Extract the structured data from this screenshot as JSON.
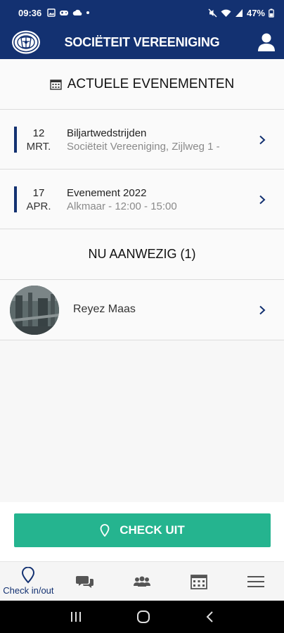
{
  "status_bar": {
    "time": "09:36",
    "battery": "47%"
  },
  "header": {
    "title": "SOCIËTEIT VEREENIGING"
  },
  "events_section": {
    "heading": "ACTUELE EVENEMENTEN",
    "items": [
      {
        "day": "12",
        "month": "MRT.",
        "name": "Biljartwedstrijden",
        "detail": "Sociëteit Vereeniging, Zijlweg 1 -"
      },
      {
        "day": "17",
        "month": "APR.",
        "name": "Evenement 2022",
        "detail": "Alkmaar - 12:00 - 15:00"
      }
    ]
  },
  "present_section": {
    "heading": "NU AANWEZIG (1)",
    "people": [
      {
        "name": "Reyez Maas"
      }
    ]
  },
  "checkout": {
    "label": "CHECK UIT"
  },
  "tabbar": {
    "items": [
      {
        "label": "Check in/out",
        "icon": "location-pin-icon"
      },
      {
        "icon": "chat-icon"
      },
      {
        "icon": "members-icon"
      },
      {
        "icon": "calendar-icon"
      },
      {
        "icon": "menu-icon"
      }
    ]
  },
  "colors": {
    "brand": "#133171",
    "accent": "#25b48f"
  }
}
